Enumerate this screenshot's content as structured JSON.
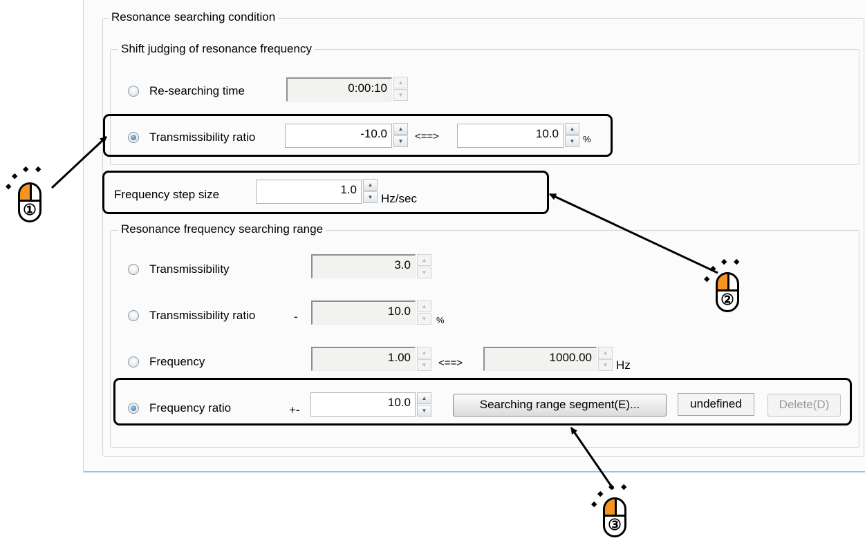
{
  "main_group": {
    "legend": "Resonance searching condition"
  },
  "shift_group": {
    "legend": "Shift judging of resonance frequency",
    "researching": {
      "label": "Re-searching time",
      "value": "0:00:10",
      "selected": false
    },
    "trans_ratio": {
      "label": "Transmissibility ratio",
      "min": "-10.0",
      "between": "<==>",
      "max": "10.0",
      "unit": "%",
      "selected": true
    }
  },
  "step": {
    "label": "Frequency step size",
    "value": "1.0",
    "unit": "Hz/sec"
  },
  "range_group": {
    "legend": "Resonance frequency searching range",
    "transmissibility": {
      "label": "Transmissibility",
      "value": "3.0",
      "selected": false
    },
    "trans_ratio": {
      "label": "Transmissibility ratio",
      "prefix": "-",
      "value": "10.0",
      "unit": "%",
      "selected": false
    },
    "frequency": {
      "label": "Frequency",
      "min": "1.00",
      "between": "<==>",
      "max": "1000.00",
      "unit": "Hz",
      "selected": false
    },
    "freq_ratio": {
      "label": "Frequency ratio",
      "prefix": "+-",
      "value": "10.0",
      "segment_button": "Searching range segment(E)...",
      "status": "undefined",
      "delete_button": "Delete(D)",
      "selected": true
    }
  },
  "callouts": [
    {
      "number": "①"
    },
    {
      "number": "②"
    },
    {
      "number": "③"
    }
  ],
  "colors": {
    "highlight": "#f7941d",
    "selection_dot": "#1f65a8",
    "panel_bottom_border": "#8ecbe0"
  }
}
